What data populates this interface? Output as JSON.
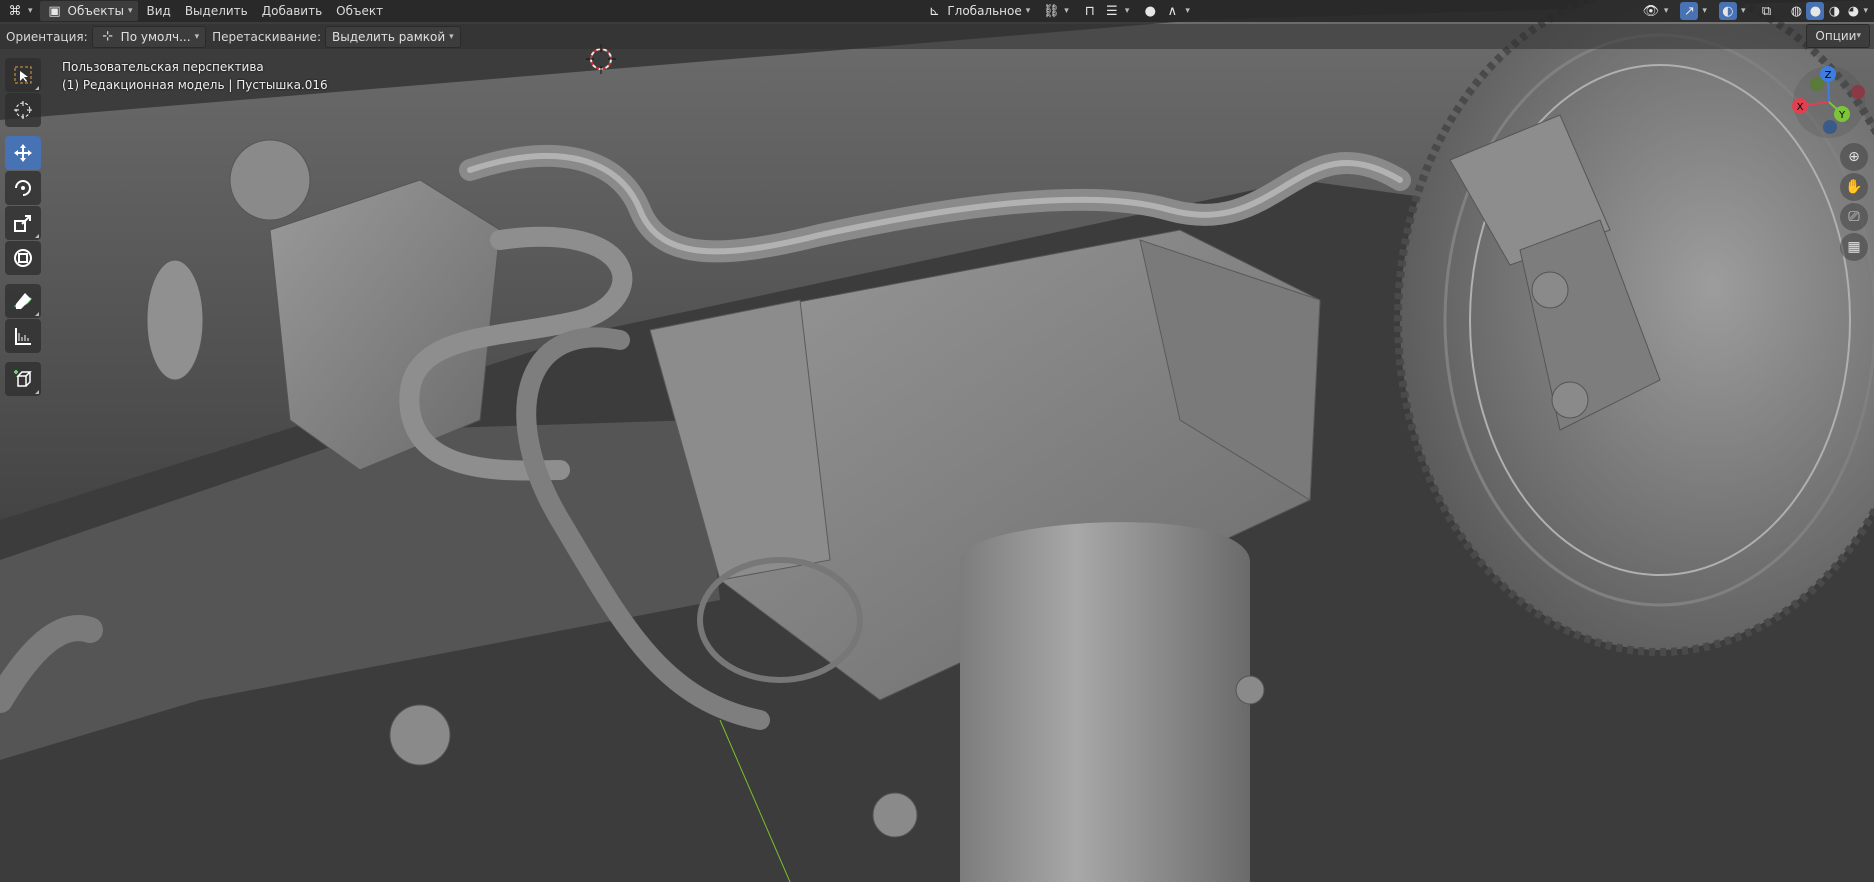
{
  "header": {
    "mode_label": "Объекты",
    "menus": [
      "Вид",
      "Выделить",
      "Добавить",
      "Объект"
    ],
    "transform_orientation": "Глобальное",
    "icons": {
      "editor_type": "editor-type-icon",
      "object_mode": "object-mode-icon",
      "orientation": "transform-orientation-icon",
      "snap": "snap-icon",
      "proportional": "proportional-edit-icon",
      "visibility": "visibility-icon",
      "gizmo": "gizmo-icon",
      "overlay": "overlay-icon",
      "xray": "xray-icon",
      "shading_wire": "wireframe-shading-icon",
      "shading_solid": "solid-shading-icon",
      "shading_material": "material-shading-icon",
      "shading_render": "rendered-shading-icon"
    }
  },
  "tool_settings": {
    "orientation_label": "Ориентация:",
    "orientation_value": "По умолч...",
    "drag_label": "Перетаскивание:",
    "drag_value": "Выделить рамкой",
    "options_label": "Опции"
  },
  "viewport": {
    "view_name": "Пользовательская перспектива",
    "object_info": "(1) Редакционная модель | Пустышка.016"
  },
  "toolbar": {
    "tools": [
      {
        "name": "select-box-icon",
        "active": false
      },
      {
        "name": "cursor-icon",
        "active": false
      },
      {
        "name": "move-icon",
        "active": true
      },
      {
        "name": "rotate-icon",
        "active": false
      },
      {
        "name": "scale-icon",
        "active": false
      },
      {
        "name": "transform-icon",
        "active": false
      },
      {
        "name": "annotate-icon",
        "active": false
      },
      {
        "name": "measure-icon",
        "active": false
      },
      {
        "name": "add-cube-icon",
        "active": false
      }
    ]
  },
  "navigation_gizmo": {
    "axes": [
      "Z",
      "X",
      "Y"
    ],
    "colors": {
      "x": "#e04050",
      "y": "#7cc43a",
      "z": "#3d7ee0"
    }
  },
  "nav_buttons": [
    "zoom-icon",
    "hand-pan-icon",
    "camera-icon",
    "ortho-grid-icon"
  ],
  "colors": {
    "accent": "#4772b3",
    "header_bg": "#282828"
  }
}
